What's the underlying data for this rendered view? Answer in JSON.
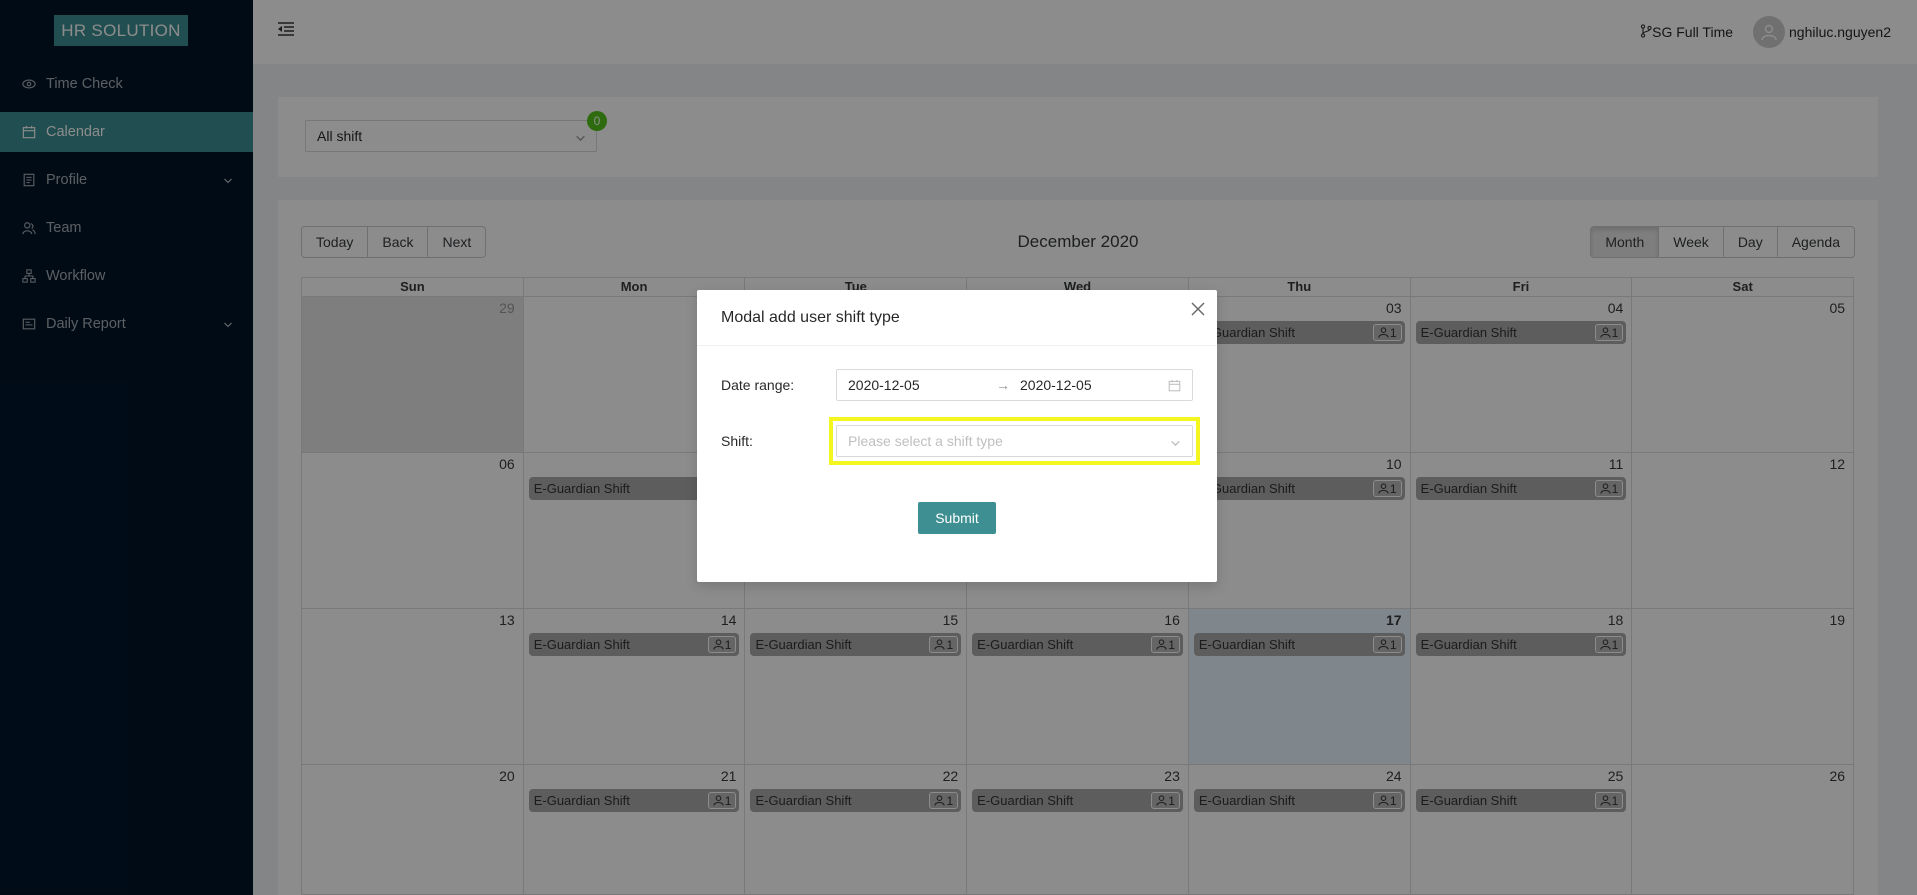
{
  "brand": "HR SOLUTION",
  "sidebar": {
    "items": [
      {
        "label": "Time Check",
        "icon": "eye-icon"
      },
      {
        "label": "Calendar",
        "icon": "calendar-icon"
      },
      {
        "label": "Profile",
        "icon": "profile-icon"
      },
      {
        "label": "Team",
        "icon": "team-icon"
      },
      {
        "label": "Workflow",
        "icon": "workflow-icon"
      },
      {
        "label": "Daily Report",
        "icon": "report-icon"
      }
    ],
    "active": "Calendar"
  },
  "header": {
    "shift_label": "SG Full Time",
    "username": "nghiluc.nguyen2"
  },
  "filter": {
    "selected": "All shift",
    "badge_count": "0"
  },
  "calendar": {
    "title": "December 2020",
    "nav_buttons": [
      "Today",
      "Back",
      "Next"
    ],
    "view_buttons": [
      "Month",
      "Week",
      "Day",
      "Agenda"
    ],
    "active_view": "Month",
    "weekdays": [
      "Sun",
      "Mon",
      "Tue",
      "Wed",
      "Thu",
      "Fri",
      "Sat"
    ],
    "weeks": [
      [
        {
          "n": "29"
        },
        {
          "n": ""
        },
        {
          "n": ""
        },
        {
          "n": ""
        },
        {
          "n": "03",
          "event": "E-Guardian Shift",
          "count": "1"
        },
        {
          "n": "04",
          "event": "E-Guardian Shift",
          "count": "1"
        },
        {
          "n": "05"
        }
      ],
      [
        {
          "n": "06"
        },
        {
          "n": "",
          "event": "E-Guardian Shift"
        },
        {
          "n": ""
        },
        {
          "n": ""
        },
        {
          "n": "10",
          "event": "E-Guardian Shift",
          "count": "1"
        },
        {
          "n": "11",
          "event": "E-Guardian Shift",
          "count": "1"
        },
        {
          "n": "12"
        }
      ],
      [
        {
          "n": "13"
        },
        {
          "n": "14",
          "event": "E-Guardian Shift",
          "count": "1"
        },
        {
          "n": "15",
          "event": "E-Guardian Shift",
          "count": "1"
        },
        {
          "n": "16",
          "event": "E-Guardian Shift",
          "count": "1"
        },
        {
          "n": "17",
          "event": "E-Guardian Shift",
          "count": "1"
        },
        {
          "n": "18",
          "event": "E-Guardian Shift",
          "count": "1"
        },
        {
          "n": "19"
        }
      ],
      [
        {
          "n": "20"
        },
        {
          "n": "21",
          "event": "E-Guardian Shift",
          "count": "1"
        },
        {
          "n": "22",
          "event": "E-Guardian Shift",
          "count": "1"
        },
        {
          "n": "23",
          "event": "E-Guardian Shift",
          "count": "1"
        },
        {
          "n": "24",
          "event": "E-Guardian Shift",
          "count": "1"
        },
        {
          "n": "25",
          "event": "E-Guardian Shift",
          "count": "1"
        },
        {
          "n": "26"
        }
      ]
    ]
  },
  "modal": {
    "title": "Modal add user shift type",
    "date_label": "Date range",
    "start_date": "2020-12-05",
    "end_date": "2020-12-05",
    "shift_label": "Shift",
    "shift_placeholder": "Please select a shift type",
    "submit_label": "Submit"
  },
  "colors": {
    "sidebar_bg": "#001529",
    "accent": "#3d8f92",
    "highlight": "#f5f51f",
    "badge": "#52c41a"
  }
}
